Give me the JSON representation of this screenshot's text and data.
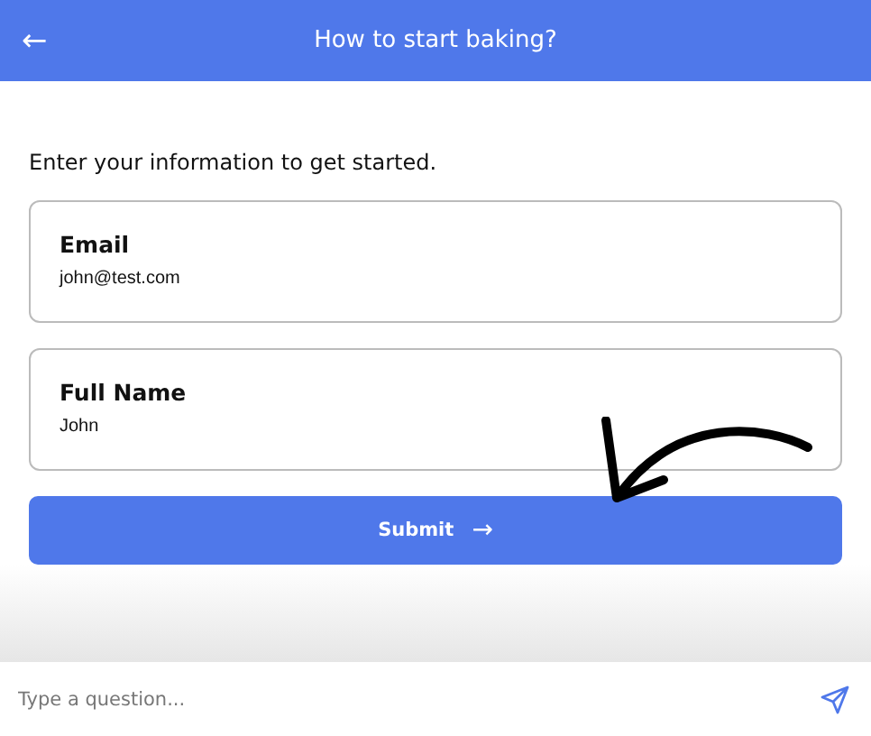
{
  "header": {
    "back_icon": "←",
    "title": "How to start baking?"
  },
  "intro": "Enter your information to get started.",
  "fields": [
    {
      "label": "Email",
      "value": "john@test.com"
    },
    {
      "label": "Full Name",
      "value": "John"
    }
  ],
  "submit_button": {
    "label": "Submit",
    "icon": "→"
  },
  "question_input": {
    "placeholder": "Type a question..."
  }
}
